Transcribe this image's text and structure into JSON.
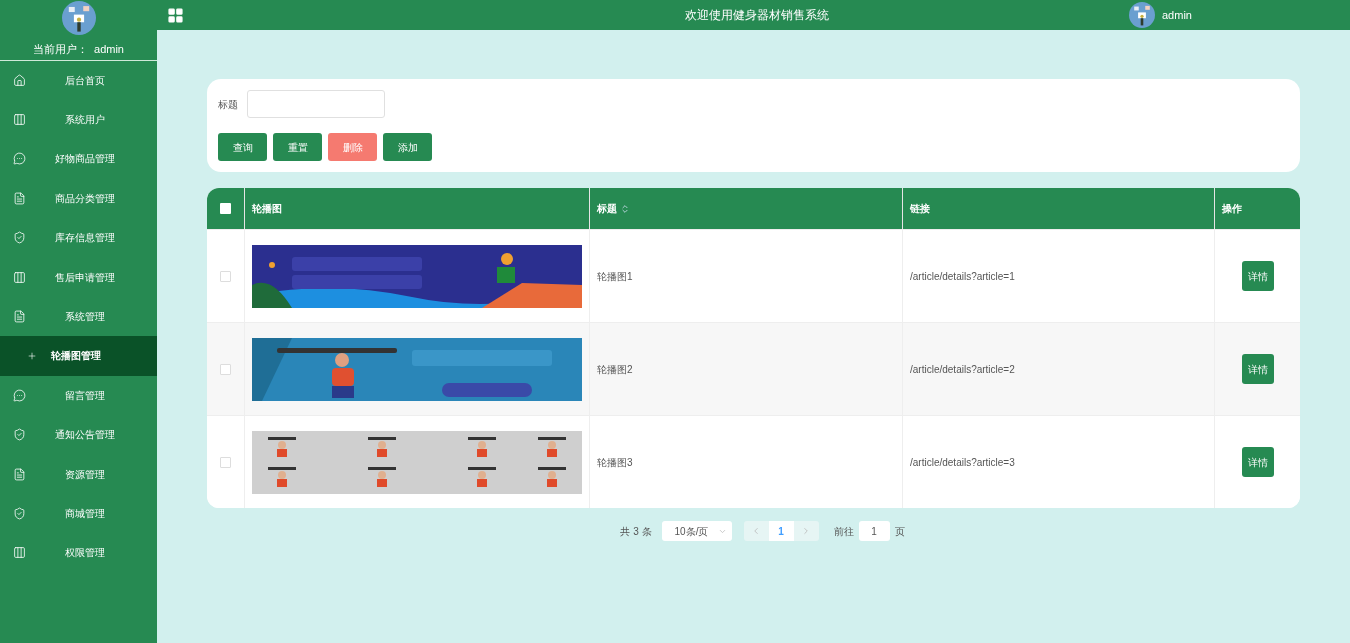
{
  "sidebar": {
    "current_user_label": "当前用户：",
    "current_user": "admin",
    "items": [
      {
        "label": "后台首页",
        "kind": "home",
        "selected": false
      },
      {
        "label": "系统用户",
        "kind": "grid",
        "selected": false
      },
      {
        "label": "好物商品管理",
        "kind": "chat",
        "selected": false
      },
      {
        "label": "商品分类管理",
        "kind": "doc",
        "selected": false
      },
      {
        "label": "库存信息管理",
        "kind": "shield",
        "selected": false
      },
      {
        "label": "售后申请管理",
        "kind": "grid",
        "selected": false
      },
      {
        "label": "系统管理",
        "kind": "doc",
        "selected": false
      },
      {
        "label": "轮播图管理",
        "kind": "plus",
        "selected": true
      },
      {
        "label": "留言管理",
        "kind": "chat",
        "selected": false
      },
      {
        "label": "通知公告管理",
        "kind": "shield",
        "selected": false
      },
      {
        "label": "资源管理",
        "kind": "doc",
        "selected": false
      },
      {
        "label": "商城管理",
        "kind": "shield",
        "selected": false
      },
      {
        "label": "权限管理",
        "kind": "grid",
        "selected": false
      }
    ]
  },
  "header": {
    "title": "欢迎使用健身器材销售系统",
    "user": "admin"
  },
  "search": {
    "label": "标题",
    "buttons": [
      {
        "label": "查询",
        "kind": "primary"
      },
      {
        "label": "重置",
        "kind": "primary"
      },
      {
        "label": "删除",
        "kind": "danger"
      },
      {
        "label": "添加",
        "kind": "primary"
      }
    ]
  },
  "table": {
    "header_checked": false,
    "columns": [
      {
        "label": "轮播图",
        "sortable": false
      },
      {
        "label": "标题",
        "sortable": true
      },
      {
        "label": "链接",
        "sortable": false
      },
      {
        "label": "操作",
        "sortable": false
      }
    ],
    "rows": [
      {
        "checked": false,
        "title": "轮播图1",
        "link": "/article/details?article=1",
        "action": "详情"
      },
      {
        "checked": false,
        "title": "轮播图2",
        "link": "/article/details?article=2",
        "action": "详情"
      },
      {
        "checked": false,
        "title": "轮播图3",
        "link": "/article/details?article=3",
        "action": "详情"
      }
    ]
  },
  "pagination": {
    "total": "共 3 条",
    "page_size": "10条/页",
    "pages": [
      {
        "label": "1",
        "selected": true
      }
    ],
    "goto_label": "前往",
    "goto_value": "1",
    "page_suffix": "页"
  }
}
